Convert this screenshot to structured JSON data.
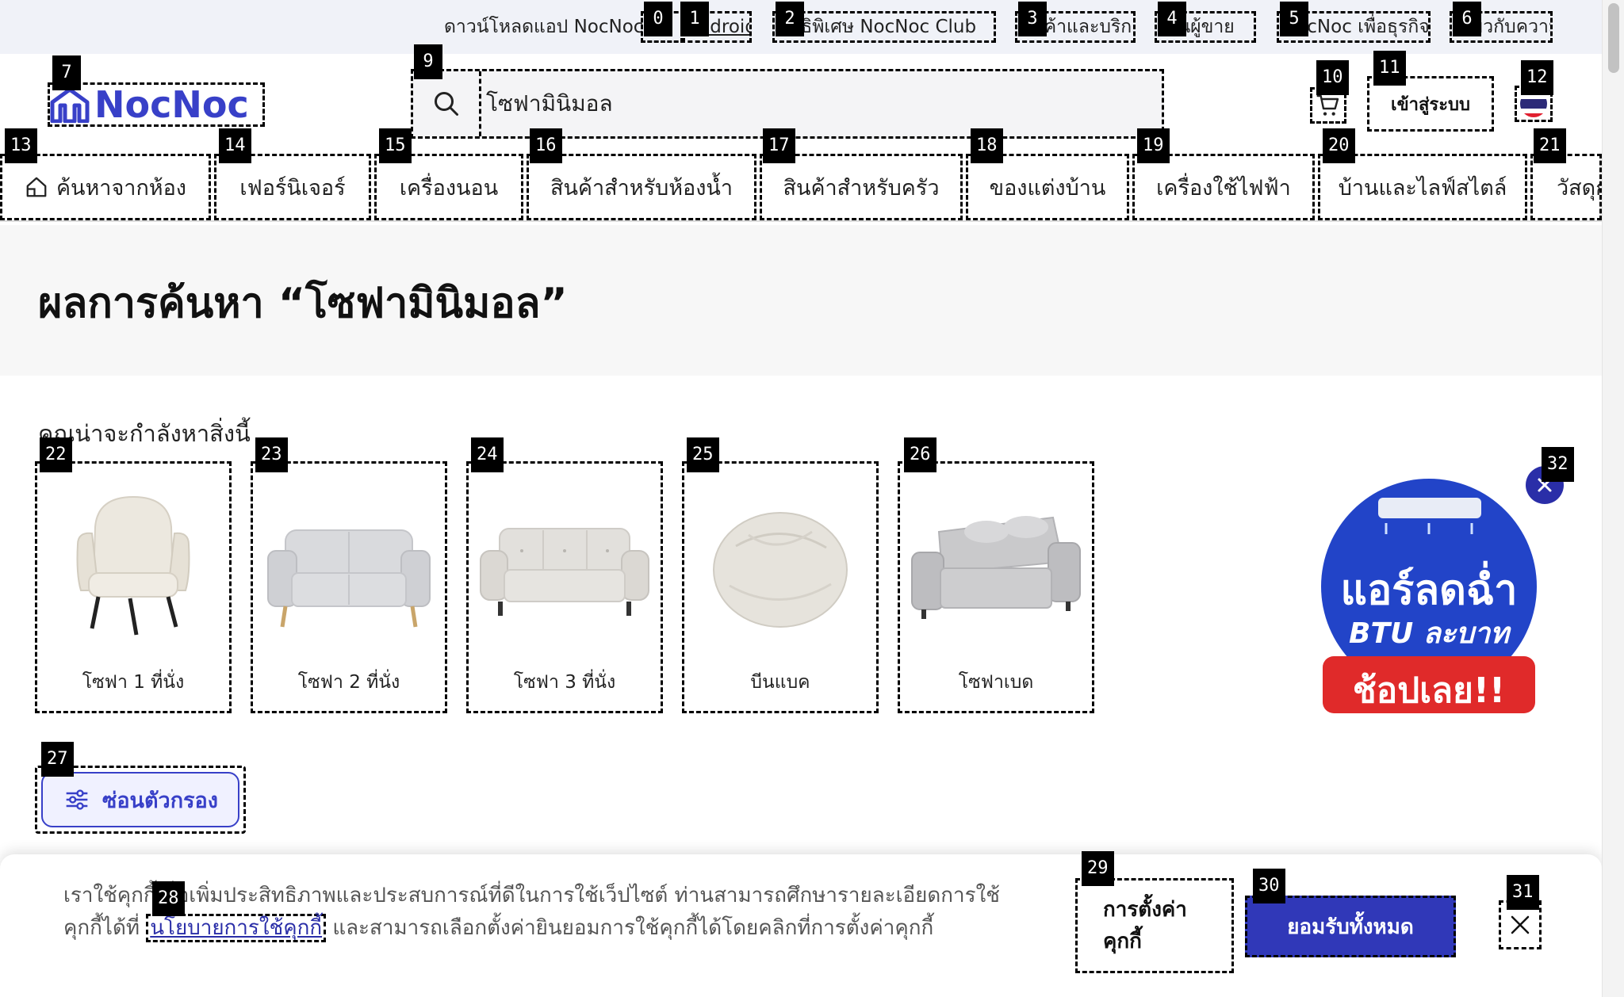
{
  "top_bar": {
    "download_text": "ดาวน์โหลดแอป NocNoc",
    "android": "Android",
    "club": "สิทธิพิเศษ NocNoc Club",
    "services": "สินค้าและบริการ",
    "seller": "เป็นผู้ขาย",
    "business": "NocNoc เพื่อธุรกิจ",
    "about": "เกี่ยวกับความน่ารู้"
  },
  "header": {
    "logo_text": "NocNoc",
    "search_value": "โซฟามินิมอล",
    "login_label": "เข้าสู่ระบบ",
    "language": "ไทย"
  },
  "categories": [
    {
      "label": "ค้นหาจากห้อง"
    },
    {
      "label": "เฟอร์นิเจอร์"
    },
    {
      "label": "เครื่องนอน"
    },
    {
      "label": "สินค้าสำหรับห้องน้ำ"
    },
    {
      "label": "สินค้าสำหรับครัว"
    },
    {
      "label": "ของแต่งบ้าน"
    },
    {
      "label": "เครื่องใช้ไฟฟ้า"
    },
    {
      "label": "บ้านและไลฟ์สไตล์"
    },
    {
      "label": "วัสดุก่อสร้าง"
    }
  ],
  "results": {
    "title": "ผลการค้นหา “โซฟามินิมอล”",
    "suggestion_heading": "คุณน่าจะกำลังหาสิ่งนี้",
    "suggestions": [
      {
        "label": "โซฟา 1 ที่นั่ง"
      },
      {
        "label": "โซฟา 2 ที่นั่ง"
      },
      {
        "label": "โซฟา 3 ที่นั่ง"
      },
      {
        "label": "บีนแบค"
      },
      {
        "label": "โซฟาเบด"
      }
    ],
    "filter_label": "ซ่อนตัวกรอง"
  },
  "ad": {
    "line1": "แอร์ลดฉ่ำ",
    "line2": "BTU ละบาท",
    "cta": "ช้อปเลย!!"
  },
  "cookie": {
    "text_before": "เราใช้คุกกี้เพื่อเพิ่มประสิทธิภาพและประสบการณ์ที่ดีในการใช้เว็ปไซต์ ท่านสามารถศึกษารายละเอียดการใช้คุกกี้ได้ที่ ",
    "policy_link": "นโยบายการใช้คุกกี้",
    "text_after": " และสามารถเลือกตั้งค่ายินยอมการใช้คุกกี้ได้โดยคลิกที่การตั้งค่าคุกกี้",
    "settings_label": "การตั้งค่าคุกกี้",
    "accept_label": "ยอมรับทั้งหมด"
  },
  "markers": [
    "0",
    "1",
    "2",
    "3",
    "4",
    "5",
    "6",
    "7",
    "9",
    "10",
    "11",
    "12",
    "13",
    "14",
    "15",
    "16",
    "17",
    "18",
    "19",
    "20",
    "21",
    "22",
    "23",
    "24",
    "25",
    "26",
    "27",
    "28",
    "29",
    "30",
    "31",
    "32"
  ],
  "colors": {
    "brand": "#3840c8",
    "accept_button": "#3038b8",
    "topbar_bg": "#f0f2f8",
    "results_bg": "#f7f7f7"
  }
}
